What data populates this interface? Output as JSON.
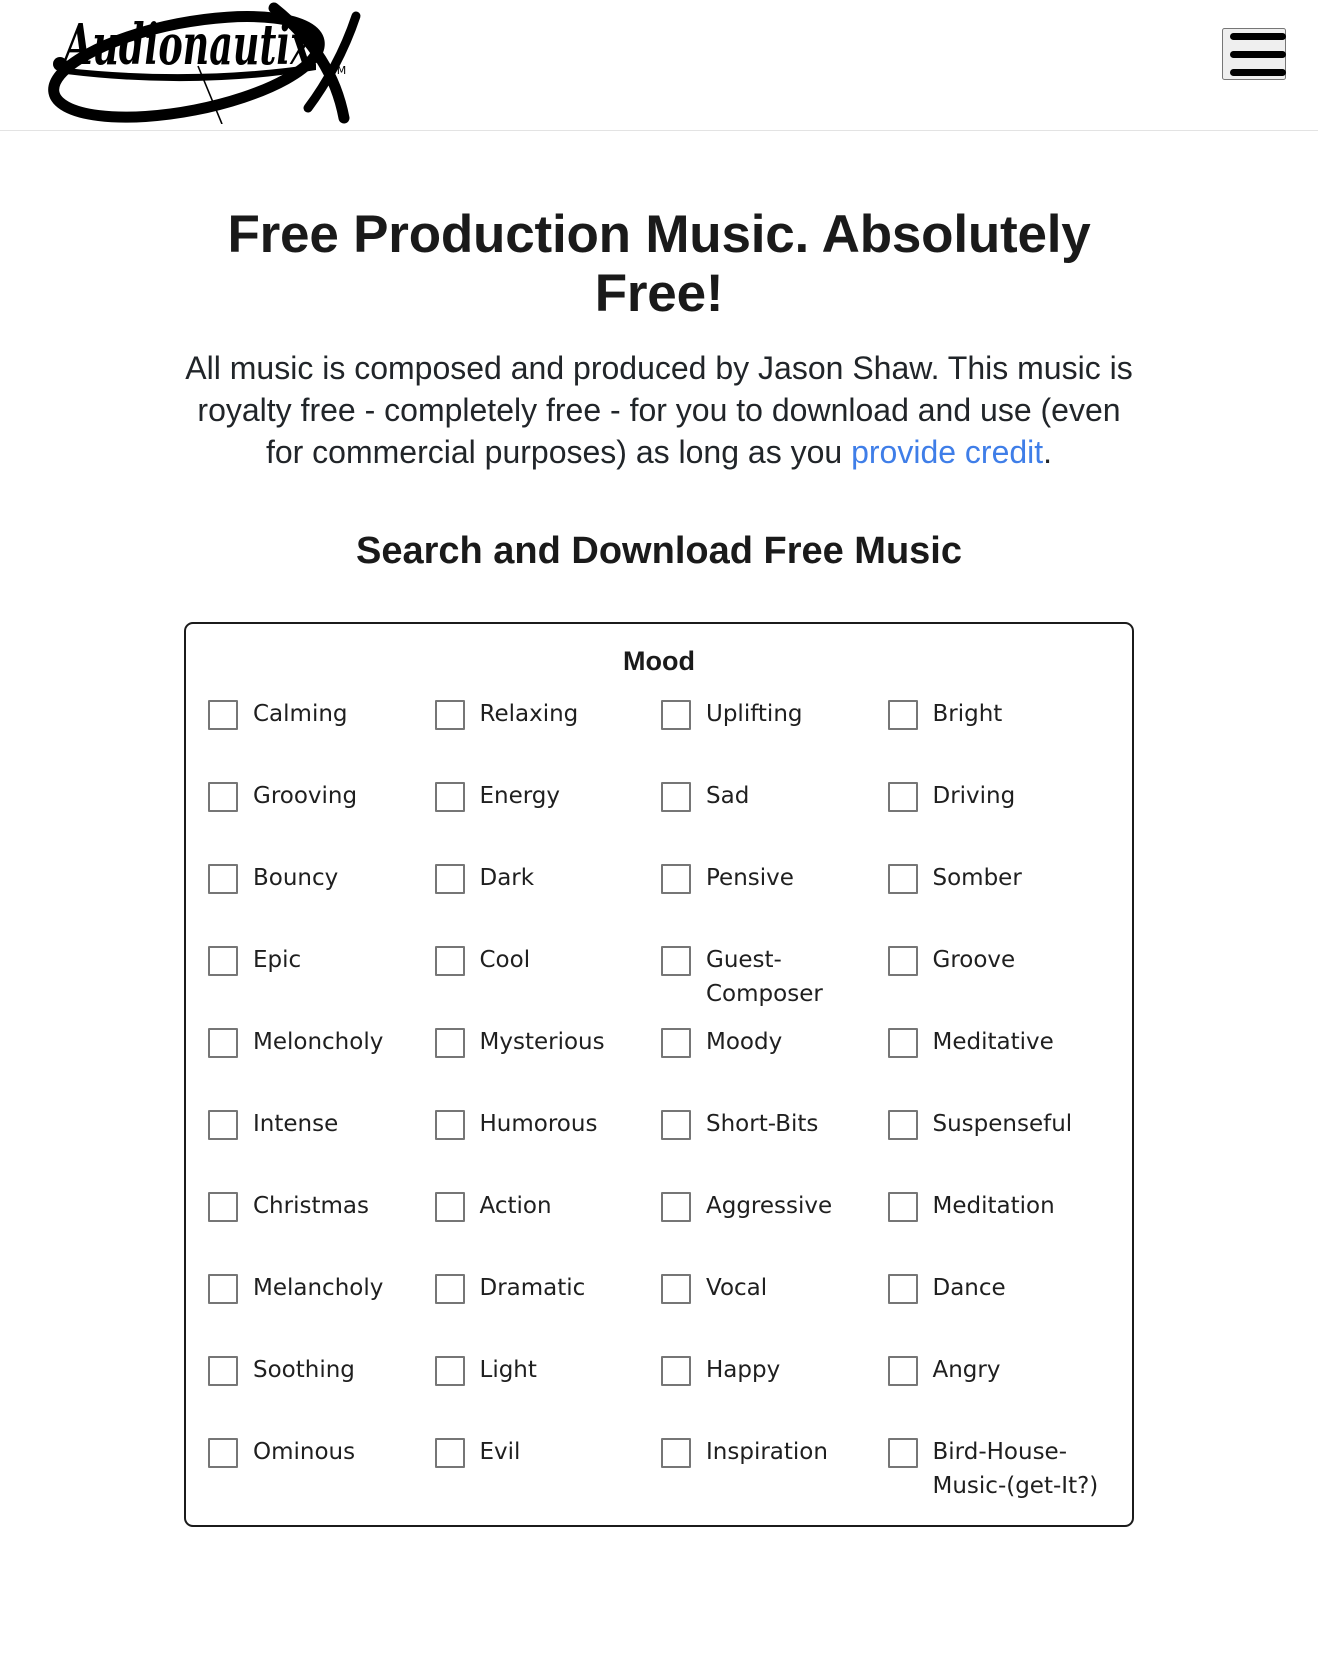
{
  "header": {
    "logo_text": "Audionautix",
    "logo_tm": "™",
    "menu_label": "Menu"
  },
  "hero": {
    "title": "Free Production Music. Absolutely Free!",
    "paragraph_before": "All music is composed and produced by Jason Shaw. This music is royalty free - completely free - for you to download and use (even for commercial purposes) as long as you ",
    "link_text": "provide credit",
    "paragraph_after": ".",
    "subtitle": "Search and Download Free Music"
  },
  "mood": {
    "legend": "Mood",
    "options": [
      "Calming",
      "Relaxing",
      "Uplifting",
      "Bright",
      "Grooving",
      "Energy",
      "Sad",
      "Driving",
      "Bouncy",
      "Dark",
      "Pensive",
      "Somber",
      "Epic",
      "Cool",
      "Guest-Composer",
      "Groove",
      "Meloncholy",
      "Mysterious",
      "Moody",
      "Meditative",
      "Intense",
      "Humorous",
      "Short-Bits",
      "Suspenseful",
      "Christmas",
      "Action",
      "Aggressive",
      "Meditation",
      "Melancholy",
      "Dramatic",
      "Vocal",
      "Dance",
      "Soothing",
      "Light",
      "Happy",
      "Angry",
      "Ominous",
      "Evil",
      "Inspiration",
      "Bird-House-Music-(get-It?)"
    ]
  },
  "colors": {
    "link": "#3f7ee8",
    "text": "#212529",
    "border": "#1b1b1b",
    "checkbox_border": "#767676"
  }
}
